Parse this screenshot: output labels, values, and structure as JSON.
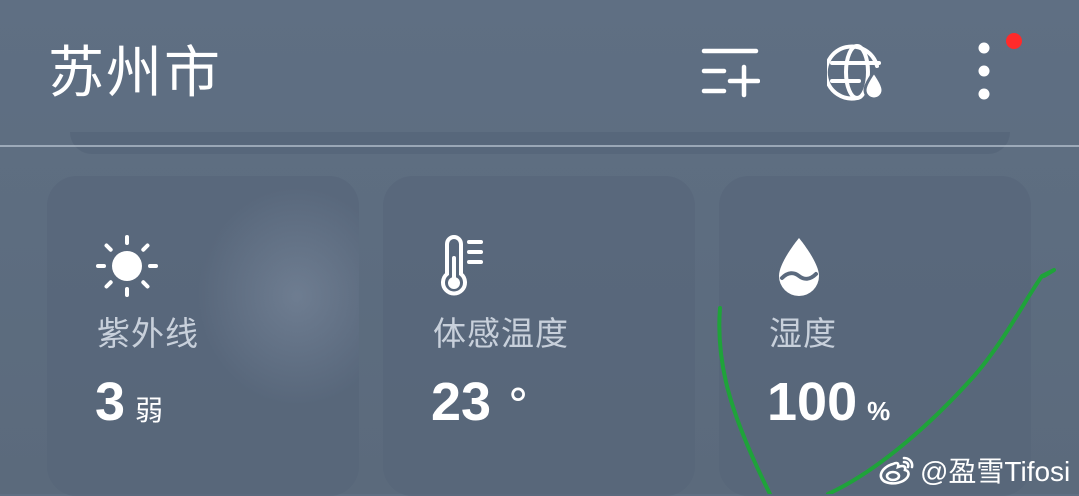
{
  "header": {
    "city": "苏州市",
    "icons": [
      "add-city-icon",
      "globe-rain-icon",
      "more-vertical-icon"
    ],
    "notification_dot_color": "#ff2a2a"
  },
  "cards": [
    {
      "icon": "sun-icon",
      "label": "紫外线",
      "value": "3",
      "unit": "弱"
    },
    {
      "icon": "thermometer-icon",
      "label": "体感温度",
      "value": "23",
      "unit": "°"
    },
    {
      "icon": "water-drop-icon",
      "label": "湿度",
      "value": "100",
      "unit": "%"
    }
  ],
  "annotation": {
    "color": "#1fa33a"
  },
  "watermark": {
    "text": "@盈雪Tifosi"
  },
  "colors": {
    "background": "#5d6d80",
    "card": "#566578",
    "text": "#ffffff"
  }
}
